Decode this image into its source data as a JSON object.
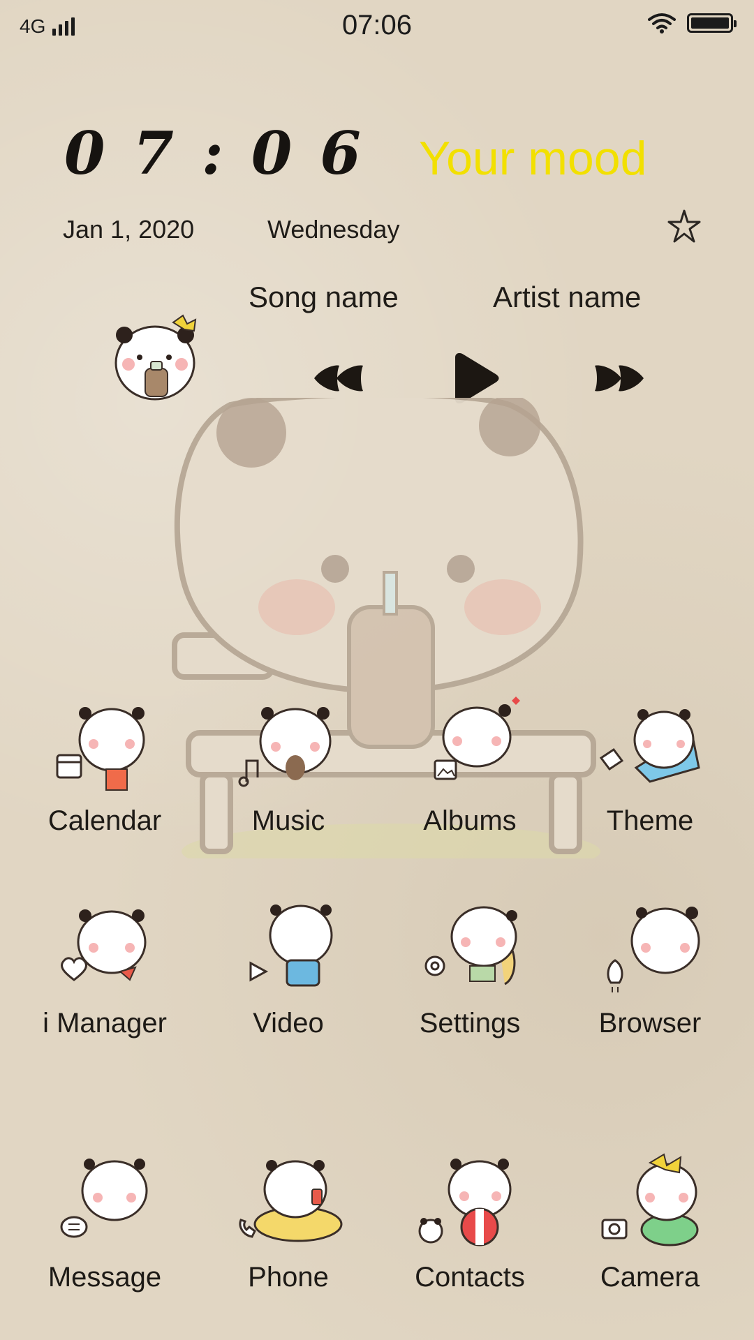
{
  "status_bar": {
    "network": "4G",
    "time": "07:06"
  },
  "widget": {
    "clock": "07:06",
    "mood": "Your mood",
    "date": "Jan 1, 2020",
    "weekday": "Wednesday"
  },
  "music": {
    "song": "Song name",
    "artist": "Artist name"
  },
  "apps": [
    {
      "label": "Calendar",
      "icon": "calendar-icon"
    },
    {
      "label": "Music",
      "icon": "music-note-icon"
    },
    {
      "label": "Albums",
      "icon": "image-icon"
    },
    {
      "label": "Theme",
      "icon": "paint-bucket-icon"
    },
    {
      "label": "i Manager",
      "icon": "heart-plus-icon"
    },
    {
      "label": "Video",
      "icon": "play-icon"
    },
    {
      "label": "Settings",
      "icon": "gear-icon"
    },
    {
      "label": "Browser",
      "icon": "rocket-icon"
    },
    {
      "label": "Message",
      "icon": "chat-bubble-icon"
    },
    {
      "label": "Phone",
      "icon": "phone-icon"
    },
    {
      "label": "Contacts",
      "icon": "panda-icon"
    },
    {
      "label": "Camera",
      "icon": "camera-icon"
    }
  ],
  "colors": {
    "background": "#e1d6c3",
    "mood_text": "#f2e000",
    "text": "#1d1a16"
  }
}
